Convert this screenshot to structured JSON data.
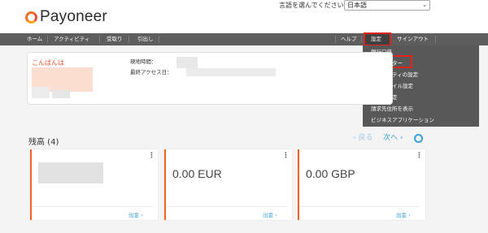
{
  "brand": {
    "name": "Payoneer"
  },
  "language": {
    "label": "言語を選んでください:",
    "selected": "日本語"
  },
  "nav": {
    "left": [
      "ホーム",
      "アクティビティ",
      "受取り",
      "引出し"
    ],
    "help": "ヘルプ",
    "settings": "設定",
    "signout": "サインアウト"
  },
  "settings_menu": {
    "items": [
      "銀行口座",
      "書類センター",
      "セキュリティの設定",
      "プロファイル設定",
      "通知の設定",
      "請求先住所を表示",
      "ビジネスアプリケーション"
    ]
  },
  "account": {
    "greeting": "こんばんは",
    "local_time_label": "現地時間：",
    "last_access_label": "最終アクセス日："
  },
  "balances": {
    "title": "残高 (4)",
    "prev": "‹ 戻る",
    "next": "次へ ›",
    "cards": [
      {
        "amount": "",
        "withdraw": "出金 ›"
      },
      {
        "amount": "0.00 EUR",
        "withdraw": "出金 ›"
      },
      {
        "amount": "0.00 GBP",
        "withdraw": "出金 ›"
      }
    ]
  },
  "colors": {
    "accent": "#f06323",
    "highlight": "#e0231d",
    "link": "#3aa0d8",
    "nav_bg": "#5d5d5d"
  },
  "icons": [
    "chevron-down-icon",
    "kebab-menu-icon",
    "settings-gear-icon"
  ]
}
